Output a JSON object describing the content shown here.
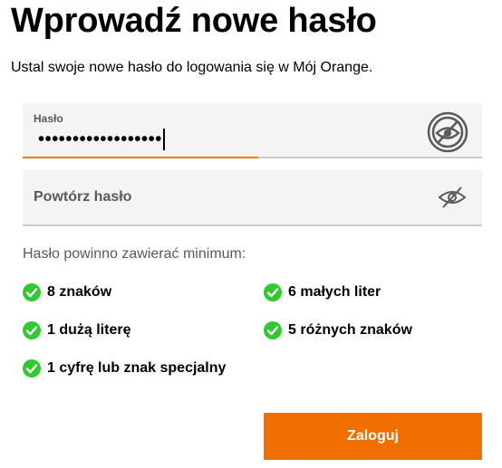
{
  "header": {
    "title": "Wprowadź nowe hasło",
    "subtitle": "Ustal swoje nowe hasło do logowania się w Mój Orange."
  },
  "password_field": {
    "label": "Hasło",
    "masked_value": "••••••••••••••••••",
    "toggle_icon": "eye-slash-icon"
  },
  "confirm_field": {
    "placeholder": "Powtórz hasło",
    "toggle_icon": "eye-slash-icon"
  },
  "requirements": {
    "heading": "Hasło powinno zawierać minimum:",
    "items": [
      "8 znaków",
      "6 małych liter",
      "1 dużą literę",
      "5 różnych znaków",
      "1 cyfrę lub znak specjalny"
    ],
    "status_icon": "check-circle-icon"
  },
  "submit": {
    "label": "Zaloguj"
  },
  "colors": {
    "accent_orange": "#f16e00",
    "check_green": "#32c832",
    "field_background": "#f4f4f4"
  }
}
